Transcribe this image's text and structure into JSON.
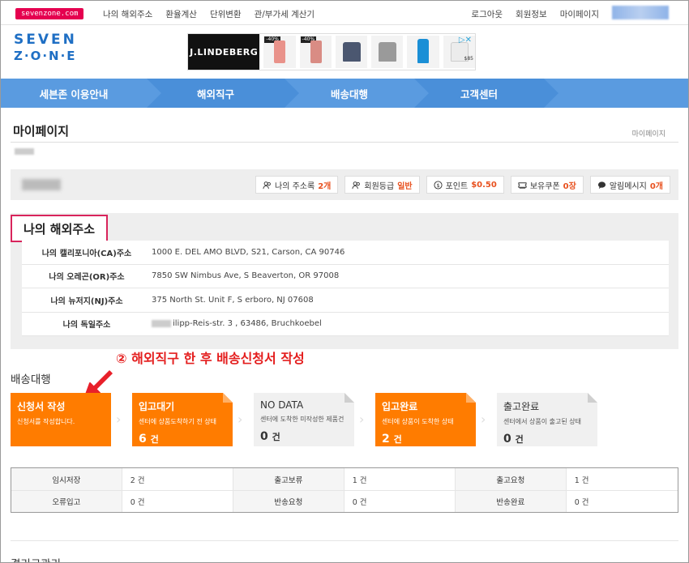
{
  "topbar": {
    "logo": "sevenzone.com",
    "nav_left": [
      "나의 해외주소",
      "환율계산",
      "단위변환",
      "관/부가세 계산기"
    ],
    "nav_right": [
      "로그아웃",
      "회원정보",
      "마이페이지"
    ]
  },
  "brand": {
    "line1": "SEVEN",
    "line2": "Z·O·N·E"
  },
  "ad": {
    "brand": "J.LINDEBERG",
    "badge1": "-40%",
    "badge2": "-40%",
    "price": "$85",
    "adchoice": "▷✕"
  },
  "mainnav": [
    "세븐존 이용안내",
    "해외직구",
    "배송대행",
    "고객센터"
  ],
  "page": {
    "title": "마이페이지",
    "breadcrumb": "마이페이지"
  },
  "userbar": {
    "pills": [
      {
        "icon": "address-book-icon",
        "label": "나의 주소록",
        "value": "2개"
      },
      {
        "icon": "member-grade-icon",
        "label": "회원등급",
        "value": "일반"
      },
      {
        "icon": "point-icon",
        "label": "포인트",
        "value": "$0.50"
      },
      {
        "icon": "coupon-icon",
        "label": "보유쿠폰",
        "value": "0장"
      },
      {
        "icon": "message-icon",
        "label": "알림메시지",
        "value": "0개"
      }
    ]
  },
  "address": {
    "title": "나의 해외주소",
    "rows": [
      {
        "label": "나의 캘리포니아(CA)주소",
        "pre": "",
        "value": "1000 E. DEL AMO BLVD, S21, Carson, CA   90746"
      },
      {
        "label": "나의 오레곤(OR)주소",
        "pre": "",
        "value": "7850 SW Nimbus Ave, S     Beaverton, OR   97008"
      },
      {
        "label": "나의 뉴저지(NJ)주소",
        "pre": "",
        "value": "375 North St. Unit F, S        erboro, NJ   07608"
      },
      {
        "label": "나의 독일주소",
        "pre": "",
        "value": "ilipp-Reis-str. 3 , 63486, Bruchkoebel"
      }
    ]
  },
  "annotation": "② 해외직구 한 후 배송신청서 작성",
  "shipping": {
    "title": "배송대행",
    "cards": [
      {
        "title": "신청서 작성",
        "desc": "신청서를 작성합니다.",
        "count": "",
        "unit": "",
        "style": "orange"
      },
      {
        "title": "입고대기",
        "desc": "센터에 상품도착하기 전 상태",
        "count": "6",
        "unit": "건",
        "style": "orange"
      },
      {
        "title": "NO DATA",
        "desc": "센터에 도착한 미작성한 제품건",
        "count": "0",
        "unit": "건",
        "style": "grey"
      },
      {
        "title": "입고완료",
        "desc": "센터에 상품이 도착한 상태",
        "count": "2",
        "unit": "건",
        "style": "orange"
      },
      {
        "title": "출고완료",
        "desc": "센터에서 상품이 출고된 상태",
        "count": "0",
        "unit": "건",
        "style": "grey"
      }
    ]
  },
  "stats": [
    [
      {
        "k": "임시저장",
        "v": "2 건"
      },
      {
        "k": "출고보류",
        "v": "1 건"
      },
      {
        "k": "출고요청",
        "v": "1 건"
      }
    ],
    [
      {
        "k": "오류입고",
        "v": "0 건"
      },
      {
        "k": "반송요청",
        "v": "0 건"
      },
      {
        "k": "반송완료",
        "v": "0 건"
      }
    ]
  ],
  "next_section": "결리구관리",
  "colors": {
    "brand_blue": "#1f6fc4",
    "nav_blue": "#5a9be0",
    "orange": "#ff7c00",
    "highlight": "#d8245b",
    "annot_red": "#e41d1d"
  }
}
